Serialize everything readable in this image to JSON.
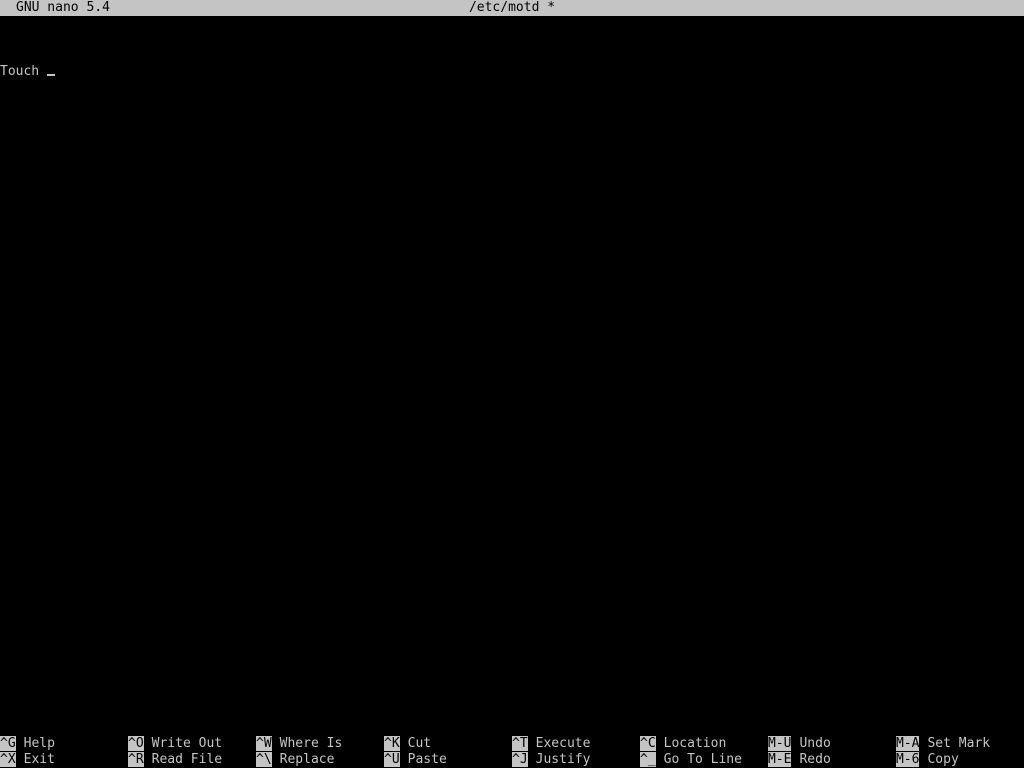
{
  "titlebar": {
    "app": "GNU nano 5.4",
    "file": "/etc/motd *"
  },
  "editor": {
    "line1": "Touch"
  },
  "shortcuts": {
    "row1": [
      {
        "key": "^G",
        "label": "Help"
      },
      {
        "key": "^O",
        "label": "Write Out"
      },
      {
        "key": "^W",
        "label": "Where Is"
      },
      {
        "key": "^K",
        "label": "Cut"
      },
      {
        "key": "^T",
        "label": "Execute"
      },
      {
        "key": "^C",
        "label": "Location"
      },
      {
        "key": "M-U",
        "label": "Undo"
      },
      {
        "key": "M-A",
        "label": "Set Mark"
      }
    ],
    "row2": [
      {
        "key": "^X",
        "label": "Exit"
      },
      {
        "key": "^R",
        "label": "Read File"
      },
      {
        "key": "^\\",
        "label": "Replace"
      },
      {
        "key": "^U",
        "label": "Paste"
      },
      {
        "key": "^J",
        "label": "Justify"
      },
      {
        "key": "^_",
        "label": "Go To Line"
      },
      {
        "key": "M-E",
        "label": "Redo"
      },
      {
        "key": "M-6",
        "label": "Copy"
      }
    ]
  },
  "colors": {
    "background": "#000000",
    "foreground": "#c4c4c4",
    "inverse_bg": "#c4c4c4",
    "inverse_fg": "#000000"
  }
}
